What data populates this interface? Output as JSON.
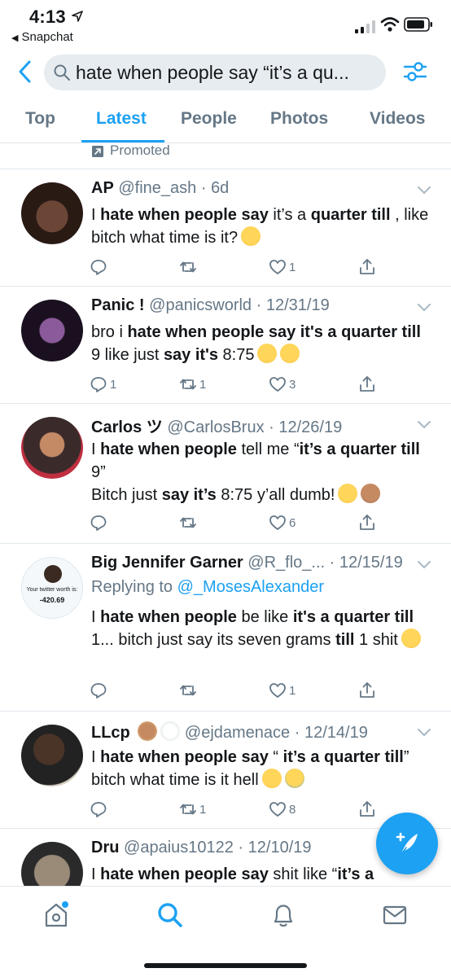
{
  "status_bar": {
    "time": "4:13",
    "back_app": "Snapchat",
    "location_icon": "location-arrow-icon",
    "signal_icon": "cellular-signal-icon",
    "wifi_icon": "wifi-icon",
    "battery_icon": "battery-icon"
  },
  "search": {
    "query": "hate when people say “it’s a qu...",
    "back_icon": "chevron-left-icon",
    "search_icon": "search-icon",
    "filter_icon": "filter-sliders-icon"
  },
  "tabs": [
    {
      "label": "Top",
      "active": false
    },
    {
      "label": "Latest",
      "active": true
    },
    {
      "label": "People",
      "active": false
    },
    {
      "label": "Photos",
      "active": false
    },
    {
      "label": "Videos",
      "active": false
    }
  ],
  "promoted": {
    "label": "Promoted",
    "icon": "promoted-arrow-icon"
  },
  "tweets": [
    {
      "name": "AP",
      "handle": "@fine_ash",
      "date": "6d",
      "text_html": "I <b>hate when people say</b> it’s a <b>quarter till</b> , like bitch what time is it?",
      "emojis": [
        "face-with-tears-of-joy"
      ],
      "replies": "",
      "retweets": "",
      "likes": "1"
    },
    {
      "name": "Panic !",
      "handle": "@panicsworld",
      "date": "12/31/19",
      "text_html": "bro i <b>hate when people say it's a quarter till</b> 9 like just <b>say it's</b> 8:75",
      "emojis": [
        "face-with-rolling-eyes",
        "face-with-rolling-eyes"
      ],
      "replies": "1",
      "retweets": "1",
      "likes": "3"
    },
    {
      "name": "Carlos ツ",
      "handle": "@CarlosBrux",
      "date": "12/26/19",
      "line1_html": "I <b>hate when people</b> tell me “<b>it’s a quarter till</b> 9”",
      "line2_html": "Bitch just <b>say it’s</b> 8:75 y’all dumb!",
      "emojis": [
        "face-with-steam-from-nose",
        "person-facepalming"
      ],
      "replies": "",
      "retweets": "",
      "likes": "6"
    },
    {
      "name": "Big Jennifer Garner",
      "handle": "@R_flo_...",
      "date": "12/15/19",
      "avatar_caption": "Your twitter worth is:",
      "avatar_value": "-420.69",
      "replying_prefix": "Replying to",
      "replying_to": "@_MosesAlexander",
      "text_html": "I <b>hate when people</b> be like <b>it's a quarter till</b> 1... bitch just say its seven grams <b>till</b> 1 shit",
      "emojis": [
        "face-with-steam-from-nose"
      ],
      "replies": "",
      "retweets": "",
      "likes": "1"
    },
    {
      "name": "LLcp",
      "handle": "@ejdamenace",
      "date": "12/14/19",
      "name_emojis": [
        "baby-angel",
        "dove"
      ],
      "text_html": "I <b>hate when people say</b> “ <b>it’s a quarter till</b>” bitch what time is it hell",
      "emojis": [
        "unamused-face",
        "loudly-crying-face"
      ],
      "replies": "",
      "retweets": "1",
      "likes": "8"
    },
    {
      "name": "Dru",
      "handle": "@apaius10122",
      "date": "12/10/19",
      "text_html": "I <b>hate when people say</b> shit like “<b>it’s a</b>",
      "emojis": [],
      "replies": "",
      "retweets": "",
      "likes": ""
    }
  ],
  "bottom_nav": [
    {
      "name": "home-icon",
      "active": false,
      "has_dot": true
    },
    {
      "name": "search-icon",
      "active": true
    },
    {
      "name": "notifications-bell-icon",
      "active": false
    },
    {
      "name": "messages-envelope-icon",
      "active": false
    }
  ],
  "fab": {
    "icon": "compose-feather-icon"
  },
  "colors": {
    "accent": "#1da1f2",
    "text": "#14171a",
    "secondary": "#657786",
    "divider": "#e1e8ed",
    "search_bg": "#e6ecf0"
  }
}
